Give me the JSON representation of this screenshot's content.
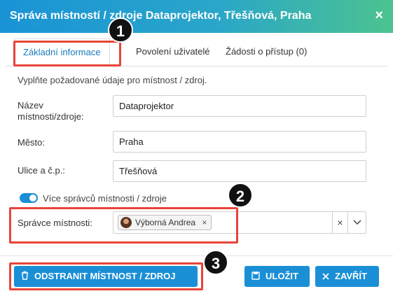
{
  "header": {
    "title": "Správa místností / zdroje Dataprojektor, Třešňová, Praha",
    "close": "×"
  },
  "tabs": [
    {
      "label": "Základní informace",
      "active": true
    },
    {
      "label": "Povolení uživatelé",
      "active": false
    },
    {
      "label": "Žádosti o přístup  (0)",
      "active": false
    }
  ],
  "form": {
    "intro": "Vyplňte požadované údaje pro místnost / zdroj.",
    "name_label": "Název místnosti/zdroje:",
    "name_value": "Dataprojektor",
    "city_label": "Město:",
    "city_value": "Praha",
    "street_label": "Ulice a č.p.:",
    "street_value": "Třešňová",
    "multi_admin_toggle": "Více správců místnosti / zdroje",
    "multi_admin_enabled": true,
    "admin_label": "Správce místnosti:",
    "admin_chip": "Výborná Andrea",
    "chip_remove": "×",
    "clear": "×"
  },
  "buttons": {
    "delete": "ODSTRANIT MÍSTNOST / ZDROJ",
    "save": "ULOŽIT",
    "close": "ZAVŘÍT"
  },
  "markers": [
    "1",
    "2",
    "3"
  ],
  "colors": {
    "accent": "#1a8fd6",
    "highlight": "#e8443a",
    "marker": "#111111"
  }
}
